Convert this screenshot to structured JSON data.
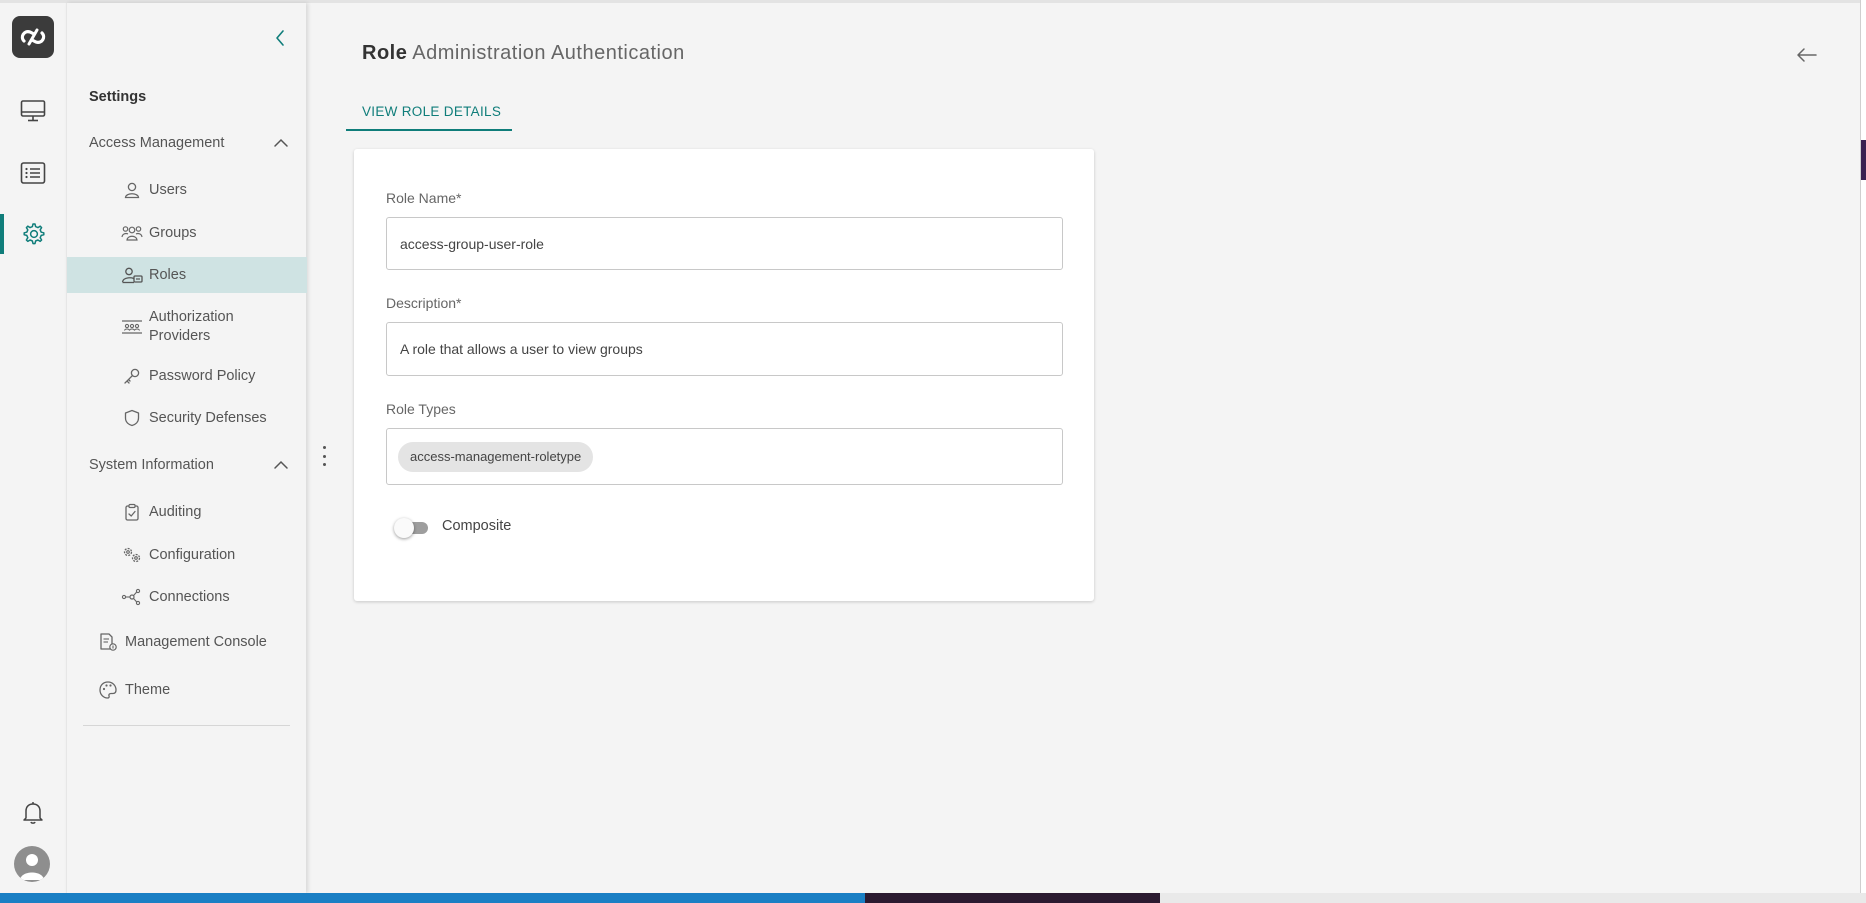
{
  "rail": {
    "items": [
      {
        "name": "monitor",
        "icon": "monitor-icon"
      },
      {
        "name": "list",
        "icon": "list-icon"
      },
      {
        "name": "settings",
        "icon": "gear-icon",
        "active": true
      }
    ],
    "accent": "#0f7d7a"
  },
  "sidebar": {
    "title": "Settings",
    "sections": [
      {
        "label": "Access Management",
        "items": [
          {
            "label": "Users",
            "icon": "user-icon"
          },
          {
            "label": "Groups",
            "icon": "groups-icon"
          },
          {
            "label": "Roles",
            "icon": "roles-icon",
            "active": true
          },
          {
            "label": "Authorization Providers",
            "icon": "authorization-providers-icon"
          },
          {
            "label": "Password Policy",
            "icon": "key-icon"
          },
          {
            "label": "Security Defenses",
            "icon": "shield-icon"
          }
        ]
      },
      {
        "label": "System Information",
        "items": [
          {
            "label": "Auditing",
            "icon": "clipboard-icon"
          },
          {
            "label": "Configuration",
            "icon": "gears-icon"
          },
          {
            "label": "Connections",
            "icon": "network-icon"
          }
        ]
      }
    ],
    "extra_items": [
      {
        "label": "Management Console",
        "icon": "console-icon"
      },
      {
        "label": "Theme",
        "icon": "palette-icon"
      }
    ]
  },
  "main": {
    "heading_bold": "Role",
    "heading_rest": "Administration Authentication",
    "tab_label": "VIEW ROLE DETAILS",
    "form": {
      "role_name_label": "Role Name*",
      "role_name_value": "access-group-user-role",
      "description_label": "Description*",
      "description_value": "A role that allows a user to view groups",
      "role_types_label": "Role Types",
      "role_types": [
        "access-management-roletype"
      ],
      "composite_label": "Composite",
      "composite_on": false
    }
  }
}
